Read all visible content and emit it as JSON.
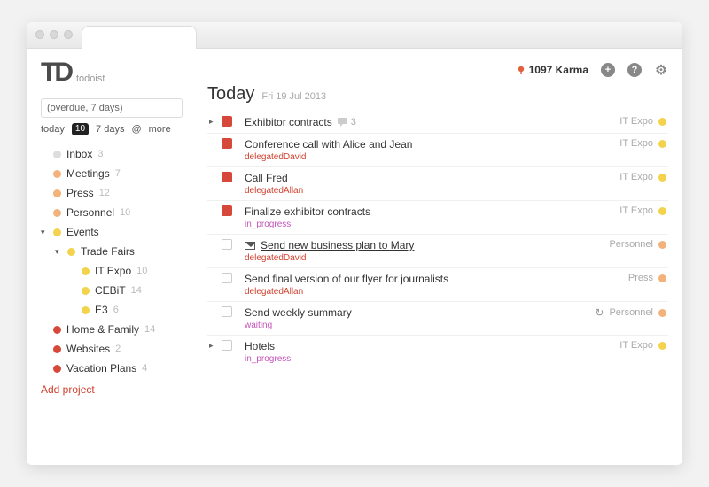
{
  "app": {
    "name": "todoist",
    "logo_text": "TD"
  },
  "header": {
    "karma_value": "1097 Karma",
    "plus_label": "+",
    "help_label": "?",
    "gear_label": "⚙"
  },
  "sidebar": {
    "filter_value": "(overdue, 7 days)",
    "tabs": {
      "today": "today",
      "today_count": "10",
      "week": "7 days",
      "at": "@",
      "more": "more"
    },
    "projects": [
      {
        "name": "Inbox",
        "count": "3",
        "color": "#dddddd",
        "indent": 0
      },
      {
        "name": "Meetings",
        "count": "7",
        "color": "#f3b27a",
        "indent": 0
      },
      {
        "name": "Press",
        "count": "12",
        "color": "#f3b27a",
        "indent": 0
      },
      {
        "name": "Personnel",
        "count": "10",
        "color": "#f3b27a",
        "indent": 0
      },
      {
        "name": "Events",
        "count": "",
        "color": "#f2d34b",
        "indent": 0,
        "caret": "▾"
      },
      {
        "name": "Trade Fairs",
        "count": "",
        "color": "#f2d34b",
        "indent": 1,
        "caret": "▾"
      },
      {
        "name": "IT Expo",
        "count": "10",
        "color": "#f2d34b",
        "indent": 2
      },
      {
        "name": "CEBiT",
        "count": "14",
        "color": "#f2d34b",
        "indent": 2
      },
      {
        "name": "E3",
        "count": "6",
        "color": "#f2d34b",
        "indent": 2
      },
      {
        "name": "Home & Family",
        "count": "14",
        "color": "#d6493a",
        "indent": 0
      },
      {
        "name": "Websites",
        "count": "2",
        "color": "#d6493a",
        "indent": 0
      },
      {
        "name": "Vacation Plans",
        "count": "4",
        "color": "#d6493a",
        "indent": 0
      }
    ],
    "add_project": "Add project"
  },
  "main": {
    "heading": "Today",
    "date": "Fri 19 Jul 2013",
    "tasks": [
      {
        "title": "Exhibitor contracts",
        "priority": "p1",
        "project": "IT Expo",
        "project_color": "#f2d34b",
        "has_children": true,
        "comments": "3"
      },
      {
        "title": "Conference call with Alice and Jean",
        "priority": "p1",
        "project": "IT Expo",
        "project_color": "#f2d34b",
        "meta": "delegatedDavid",
        "meta_style": "red"
      },
      {
        "title": "Call Fred",
        "priority": "p1",
        "project": "IT Expo",
        "project_color": "#f2d34b",
        "meta": "delegatedAllan",
        "meta_style": "red"
      },
      {
        "title": "Finalize exhibitor contracts",
        "priority": "p1",
        "project": "IT Expo",
        "project_color": "#f2d34b",
        "meta": "in_progress",
        "meta_style": "mag"
      },
      {
        "title": "Send new business plan to Mary",
        "priority": "p3",
        "project": "Personnel",
        "project_color": "#f3b27a",
        "meta": "delegatedDavid",
        "meta_style": "red",
        "email": true,
        "underline": true
      },
      {
        "title": "Send final version of our flyer for journalists",
        "priority": "p3",
        "project": "Press",
        "project_color": "#f3b27a",
        "meta": "delegatedAllan",
        "meta_style": "red"
      },
      {
        "title": "Send weekly summary",
        "priority": "p3",
        "project": "Personnel",
        "project_color": "#f3b27a",
        "meta": "waiting",
        "meta_style": "mag",
        "recurring": true
      },
      {
        "title": "Hotels",
        "priority": "p3",
        "project": "IT Expo",
        "project_color": "#f2d34b",
        "meta": "in_progress",
        "meta_style": "mag",
        "has_children": true
      }
    ]
  },
  "colors": {
    "accent_red": "#d0402e"
  }
}
